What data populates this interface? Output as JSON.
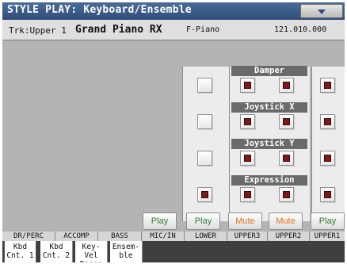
{
  "title": "STYLE PLAY: Keyboard/Ensemble",
  "track": {
    "label": "Trk:Upper 1",
    "sound": "Grand Piano RX",
    "bank": "F-Piano",
    "id": "121.010.000"
  },
  "sections": [
    {
      "label": "Damper"
    },
    {
      "label": "Joystick X"
    },
    {
      "label": "Joystick Y"
    },
    {
      "label": "Expression"
    }
  ],
  "switches": {
    "lower": [
      false,
      false,
      false,
      true
    ],
    "upper3": [
      true,
      true,
      true,
      true
    ],
    "upper2": [
      true,
      true,
      true,
      true
    ],
    "upper1": [
      true,
      true,
      true,
      true
    ]
  },
  "buttons": {
    "mic_in": "Play",
    "lower": "Play",
    "upper3": "Mute",
    "upper2": "Mute",
    "upper1": "Play"
  },
  "track_names": [
    "DR/PERC",
    "ACCOMP",
    "BASS",
    "MIC/IN",
    "LOWER",
    "UPPER3",
    "UPPER2",
    "UPPER1"
  ],
  "tabs": [
    {
      "label": "Kbd\nCnt. 1",
      "active": true
    },
    {
      "label": "Kbd\nCnt. 2",
      "active": false
    },
    {
      "label": "Key-Vel\nRange",
      "active": false
    },
    {
      "label": "Ensem-\nble",
      "active": false
    }
  ],
  "colors": {
    "title_bar": "#2f4d78",
    "play": "#2f7d2f",
    "mute": "#e07020",
    "led_on": "#7a1a1a"
  }
}
